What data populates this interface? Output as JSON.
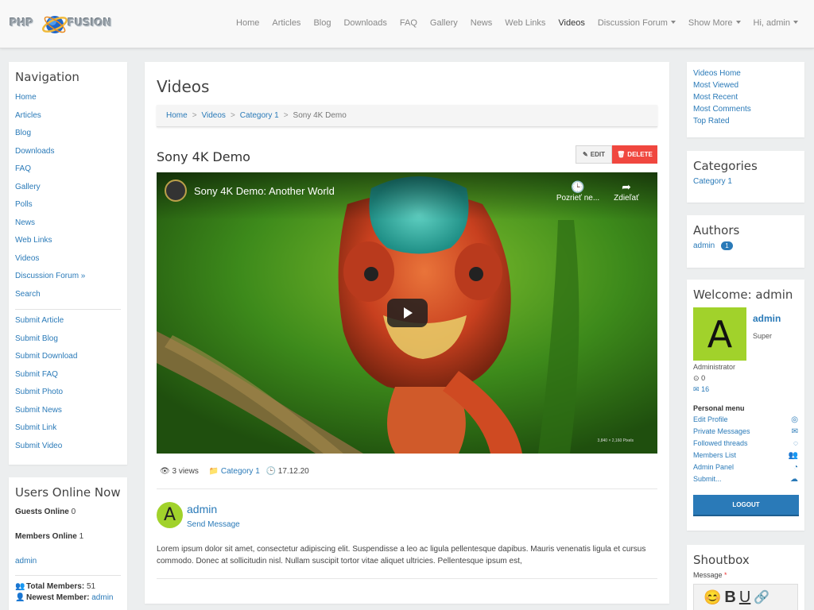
{
  "brand": {
    "logo_text_left": "PHP",
    "logo_text_right": "FUSION"
  },
  "topnav": {
    "items": [
      "Home",
      "Articles",
      "Blog",
      "Downloads",
      "FAQ",
      "Gallery",
      "News",
      "Web Links",
      "Videos"
    ],
    "dropdowns": [
      "Discussion Forum",
      "Show More",
      "Hi, admin"
    ],
    "active": "Videos"
  },
  "left_nav": {
    "title": "Navigation",
    "items": [
      "Home",
      "Articles",
      "Blog",
      "Downloads",
      "FAQ",
      "Gallery",
      "Polls",
      "News",
      "Web Links",
      "Videos",
      "Discussion Forum »",
      "Search"
    ],
    "submit_items": [
      "Submit Article",
      "Submit Blog",
      "Submit Download",
      "Submit FAQ",
      "Submit Photo",
      "Submit News",
      "Submit Link",
      "Submit Video"
    ]
  },
  "users_online": {
    "title": "Users Online Now",
    "guests_label": "Guests Online",
    "guests_count": "0",
    "members_label": "Members Online",
    "members_count": "1",
    "member_name": "admin",
    "total_label": "Total Members:",
    "total_value": "51",
    "newest_label": "Newest Member:",
    "newest_value": "admin"
  },
  "main": {
    "title": "Videos",
    "breadcrumb": [
      "Home",
      "Videos",
      "Category 1",
      "Sony 4K Demo"
    ],
    "breadcrumb_sep": ">",
    "video_title": "Sony 4K Demo",
    "edit_label": "EDIT",
    "delete_label": "DELETE",
    "player": {
      "title": "Sony 4K Demo: Another World",
      "watch_later": "Pozrieť ne...",
      "share": "Zdieľať",
      "resolution": "3,840 × 2,160 Pixels"
    },
    "meta": {
      "views": "3 views",
      "category": "Category 1",
      "date": "17.12.20"
    },
    "author": {
      "initial": "A",
      "name": "admin",
      "send_message": "Send Message"
    },
    "body": "Lorem ipsum dolor sit amet, consectetur adipiscing elit. Suspendisse a leo ac ligula pellentesque dapibus. Mauris venenatis ligula et cursus commodo. Donec at sollicitudin nisl. Nullam suscipit tortor vitae aliquet ultricies. Pellentesque ipsum est,"
  },
  "right": {
    "video_links": [
      "Videos Home",
      "Most Viewed",
      "Most Recent",
      "Most Comments",
      "Top Rated"
    ],
    "categories_title": "Categories",
    "categories": [
      "Category 1"
    ],
    "authors_title": "Authors",
    "authors": [
      {
        "name": "admin",
        "count": "1"
      }
    ],
    "welcome_title": "Welcome: admin",
    "avatar_initial": "A",
    "user_name": "admin",
    "role_line1": "Super",
    "role_line2": "Administrator",
    "count_a": "0",
    "count_b": "16",
    "personal_menu_title": "Personal menu",
    "personal_menu": [
      "Edit Profile",
      "Private Messages",
      "Followed threads",
      "Members List",
      "Admin Panel",
      "Submit..."
    ],
    "logout_label": "LOGOUT",
    "shoutbox_title": "Shoutbox",
    "message_label": "Message",
    "required_mark": "*"
  },
  "colors": {
    "link": "#2a7ab8",
    "delete": "#f0473f",
    "avatar_bg": "#a1d22b"
  }
}
